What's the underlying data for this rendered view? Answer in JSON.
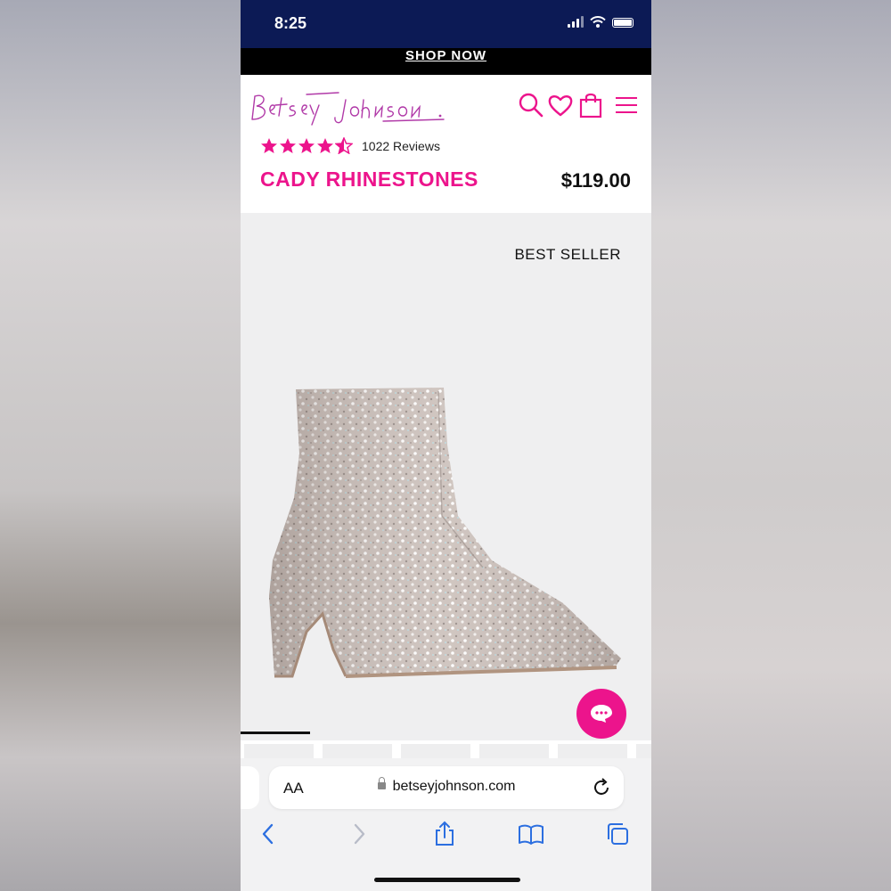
{
  "status_bar": {
    "time": "8:25"
  },
  "promo": {
    "link_label": "SHOP NOW"
  },
  "header": {
    "brand": "Betsey Johnson",
    "icons": [
      "search-icon",
      "heart-icon",
      "shopping-bag-icon",
      "menu-icon"
    ]
  },
  "product": {
    "rating": 4.5,
    "reviews_label": "1022 Reviews",
    "name": "CADY RHINESTONES",
    "price": "$119.00",
    "badge": "BEST SELLER"
  },
  "browser": {
    "text_size_label": "AA",
    "url": "betseyjohnson.com",
    "toolbar": [
      "back-icon",
      "forward-icon",
      "share-icon",
      "bookmarks-icon",
      "tabs-icon"
    ]
  },
  "colors": {
    "brand_pink": "#ec148c",
    "status_bar": "#0c1a55",
    "promo_bar": "#000000"
  }
}
